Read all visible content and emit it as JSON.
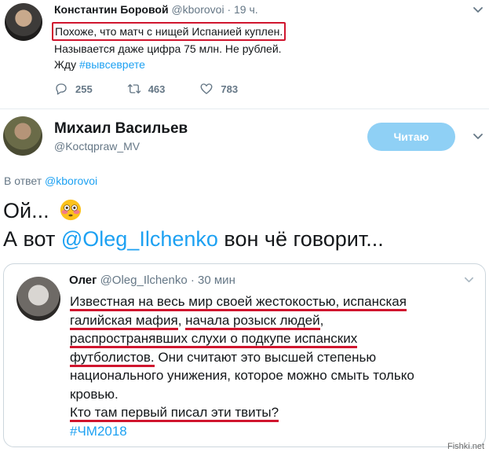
{
  "tweet1": {
    "name": "Константин Боровой",
    "handle": "@kborovoi",
    "time": "· 19 ч.",
    "lines": [
      "Похоже, что матч с нищей Испанией куплен.",
      "Называется даже цифра 75 млн. Не рублей.",
      "Жду"
    ],
    "hashtag": "#вывсеврете",
    "replies": "255",
    "retweets": "463",
    "likes": "783"
  },
  "tweet2": {
    "name": "Михаил Васильев",
    "handle": "@Koctqpraw_MV",
    "follow_label": "Читаю",
    "reply_prefix": "В ответ",
    "reply_handle": "@kborovoi",
    "line1": "Ой...",
    "line2_prefix": "А вот",
    "mention": "@Oleg_Ilchenko",
    "line2_suffix": "вон чё говорит..."
  },
  "quote": {
    "name": "Олег",
    "handle": "@Oleg_Ilchenko",
    "time": "· 30 мин",
    "l1": "Известная на весь мир своей жестокостью, испанская",
    "l2a": "галийская мафия",
    "l2b": ", ",
    "l2c": "начала розыск людей",
    "l2d": ",",
    "l3": "распространявших слухи о подкупе испанских",
    "l4a": "футболистов.",
    "l4b": " Они считают это высшей степенью",
    "l5": "национального унижения, которое можно смыть только",
    "l6": "кровью.",
    "l7": "Кто там первый писал эти твиты?",
    "hashtag": "#ЧМ2018"
  },
  "watermark": "Fishki.net",
  "colors": {
    "link": "#1da1f2",
    "muted": "#657786",
    "highlight": "#d0152e",
    "follow_button": "#8fd0f5"
  }
}
